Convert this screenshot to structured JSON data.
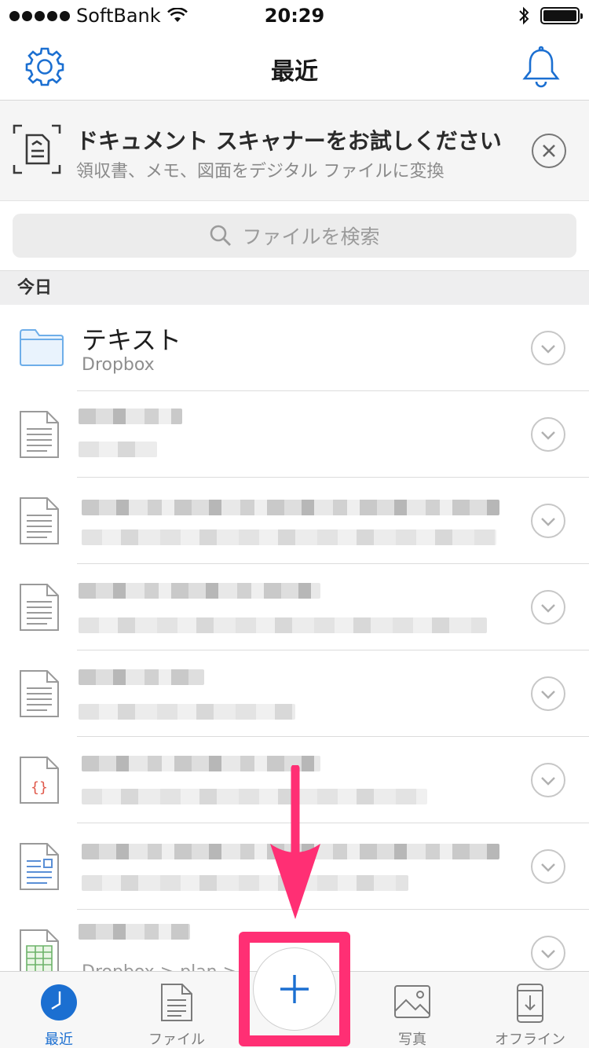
{
  "status_bar": {
    "carrier": "SoftBank",
    "time": "20:29"
  },
  "nav": {
    "title": "最近",
    "left_icon": "gear-icon",
    "right_icon": "bell-icon"
  },
  "banner": {
    "title": "ドキュメント スキャナーをお試しください",
    "subtitle": "領収書、メモ、図面をデジタル ファイルに変換",
    "close_icon": "close-circle-icon"
  },
  "search": {
    "placeholder": "ファイルを検索"
  },
  "section": {
    "label": "今日"
  },
  "items": [
    {
      "name": "テキスト",
      "sub": "Dropbox",
      "icon": "folder-icon"
    },
    {
      "icon": "document-icon",
      "blurred": true
    },
    {
      "icon": "document-icon",
      "blurred": true
    },
    {
      "icon": "document-icon",
      "blurred": true
    },
    {
      "icon": "document-icon",
      "blurred": true
    },
    {
      "icon": "code-file-icon",
      "blurred": true
    },
    {
      "icon": "image-file-icon",
      "blurred": true
    },
    {
      "icon": "spreadsheet-icon",
      "sub": "Dropbox > plan > ...",
      "blurred": true
    }
  ],
  "tabs": [
    {
      "label": "最近",
      "icon": "clock-icon",
      "active": true
    },
    {
      "label": "ファイル",
      "icon": "file-icon",
      "active": false
    },
    {
      "label": "写真",
      "icon": "photo-icon",
      "active": false
    },
    {
      "label": "オフライン",
      "icon": "offline-device-icon",
      "active": false
    }
  ],
  "colors": {
    "accent": "#1b6fd1",
    "highlight": "#ff2f74"
  }
}
